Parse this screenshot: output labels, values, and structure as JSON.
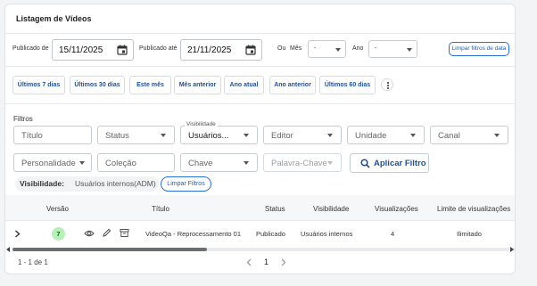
{
  "page": {
    "title": "Listagem de Vídeos"
  },
  "date_filters": {
    "published_from_label": "Publicado de",
    "published_from_value": "15/11/2025",
    "published_to_label": "Publicado até",
    "published_to_value": "21/11/2025",
    "or_label": "Ou",
    "month_label": "Mês",
    "month_value": "-",
    "year_label": "Ano",
    "year_value": "-",
    "clear_dates_label": "Limpar filtros de data"
  },
  "quick_ranges": [
    "Últimos 7 dias",
    "Últimos 30 dias",
    "Este mês",
    "Mês anterior",
    "Ano atual",
    "Ano anterior",
    "Últimos 60 dias"
  ],
  "filters": {
    "section_label": "Filtros",
    "titulo_placeholder": "Título",
    "status_placeholder": "Status",
    "visibilidade_label": "Visibilidade",
    "visibilidade_value": "Usuários...",
    "editor_placeholder": "Editor",
    "unidade_placeholder": "Unidade",
    "canal_placeholder": "Canal",
    "personalidade_placeholder": "Personalidade",
    "colecao_placeholder": "Coleção",
    "chave_placeholder": "Chave",
    "palavra_chave_placeholder": "Palavra-Chave",
    "apply_label": "Aplicar Filtro",
    "active_filter_key": "Visibilidade:",
    "active_filter_value": "Usuários internos(ADM)",
    "clear_filters_label": "Limpar Filtros"
  },
  "table": {
    "headers": [
      "Versão",
      "Título",
      "Status",
      "Visibilidade",
      "Visualizações",
      "Limite de visualizações"
    ],
    "rows": [
      {
        "versao": "7",
        "titulo": "VideoQa - Reprocessamento 01",
        "status": "Publicado",
        "visibilidade": "Usuários internos",
        "visualizacoes": "4",
        "limite": "Ilimitado"
      }
    ]
  },
  "pagination": {
    "range": "1 - 1 de 1",
    "current_page": "1"
  },
  "colors": {
    "accent": "#2a6fd6",
    "chip_text": "#1f4f99",
    "badge_bg": "#b7efb9"
  }
}
